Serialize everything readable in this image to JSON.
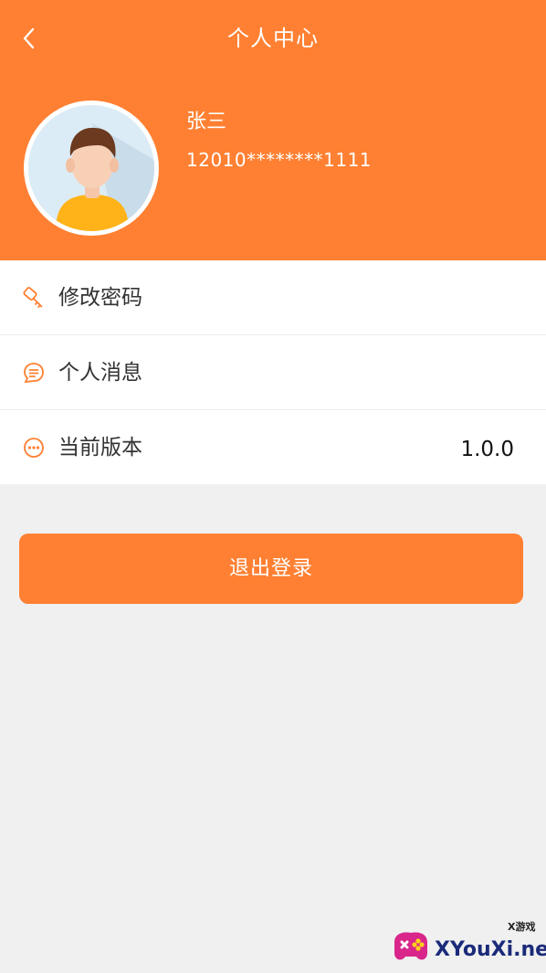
{
  "header": {
    "title": "个人中心",
    "background_color": "#ff8032",
    "back_icon": "chevron-left-icon"
  },
  "user": {
    "name": "张三",
    "id": "12010********1111",
    "avatar_icon": "user-avatar-icon"
  },
  "menu": {
    "items": [
      {
        "label": "修改密码",
        "icon": "key-icon",
        "value": ""
      },
      {
        "label": "个人消息",
        "icon": "message-icon",
        "value": ""
      },
      {
        "label": "当前版本",
        "icon": "more-dots-icon",
        "value": "1.0.0"
      }
    ]
  },
  "logout": {
    "label": "退出登录"
  },
  "watermark": {
    "brand": "XYouXi.net",
    "small": "X游戏"
  },
  "colors": {
    "accent": "#ff8032",
    "page_bg": "#f0f0f0"
  }
}
